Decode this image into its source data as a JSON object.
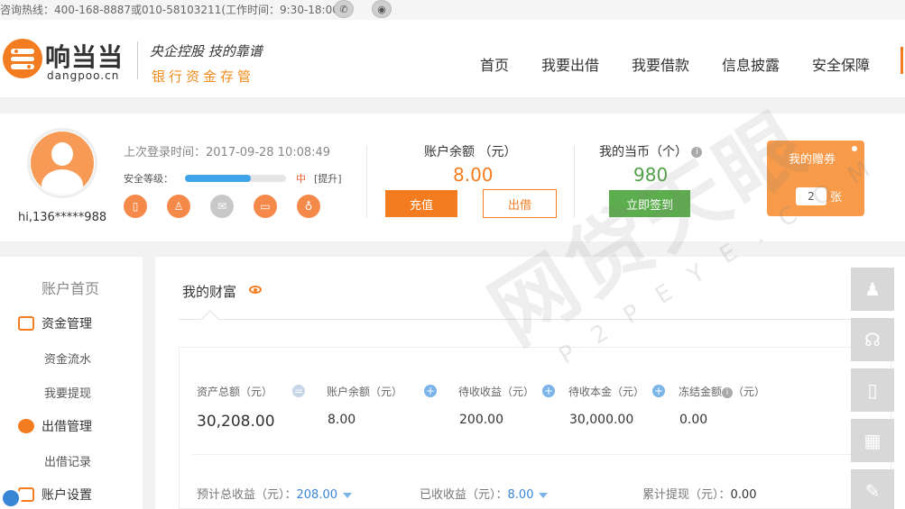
{
  "topbar": {
    "hotline": "咨询热线：400-168-8887或010-58103211(工作时间：9:30-18:00)",
    "wechat_icon": "wechat-icon",
    "weibo_icon": "weibo-icon"
  },
  "brand": {
    "name": "响当当",
    "domain": "dangpoo.cn",
    "slogan_top": "央企控股 技的靠谱",
    "slogan_bottom": "银行资金存管",
    "accent": "#f47c20"
  },
  "nav": {
    "items": [
      "首页",
      "我要出借",
      "我要借款",
      "信息披露",
      "安全保障"
    ]
  },
  "user": {
    "greeting": "hi,136*****988",
    "last_login": "上次登录时间：2017-09-28 10:08:49",
    "security_label": "安全等级：",
    "security_level": "中",
    "security_fraction": 0.65,
    "security_upgrade": "[提升]",
    "security_icons": [
      "phone-icon",
      "identity-icon",
      "email-icon",
      "bank-card-icon",
      "password-icon"
    ]
  },
  "balance": {
    "label": "账户余额 （元）",
    "value": "8.00",
    "recharge": "充值",
    "invest": "出借"
  },
  "coins": {
    "label": "我的当币（个）",
    "value": "980",
    "signin": "立即签到"
  },
  "coupon": {
    "title": "我的赠券",
    "count": "2",
    "unit": "张"
  },
  "sidebar": {
    "home": "账户首页",
    "groups": [
      {
        "label": "资金管理",
        "items": [
          "资金流水",
          "我要提现"
        ]
      },
      {
        "label": "出借管理",
        "items": [
          "出借记录"
        ]
      },
      {
        "label": "账户设置",
        "items": []
      }
    ]
  },
  "wealth": {
    "title": "我的财富",
    "stats": [
      {
        "label": "资产总额（元）",
        "value": "30,208.00"
      },
      {
        "label": "账户余额（元）",
        "value": "8.00"
      },
      {
        "label": "待收收益（元）",
        "value": "200.00"
      },
      {
        "label": "待收本金（元）",
        "value": "30,000.00"
      },
      {
        "label": "冻结金额",
        "label_suffix": "（元）",
        "value": "0.00"
      }
    ],
    "expected_label": "预计总收益（元）：",
    "expected_value": "208.00",
    "received_label": "已收收益（元）：",
    "received_value": "8.00",
    "withdrawn_label": "累计提现（元）：",
    "withdrawn_value": "0.00"
  },
  "float_toolbar": [
    "user-add-icon",
    "customer-service-icon",
    "mobile-icon",
    "qrcode-icon",
    "edit-icon"
  ],
  "watermark": {
    "text": "网贷天眼",
    "sub": "P2PEYE.COM"
  }
}
